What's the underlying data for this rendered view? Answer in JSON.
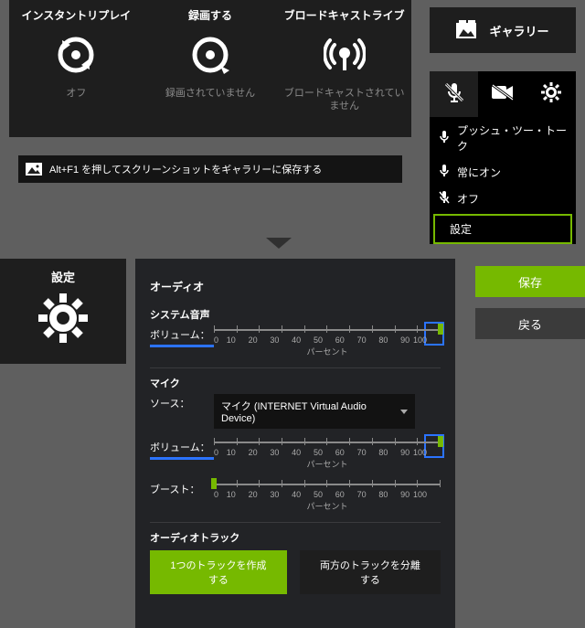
{
  "top": {
    "tiles": [
      {
        "title": "インスタントリプレイ",
        "status": "オフ"
      },
      {
        "title": "録画する",
        "status": "録画されていません"
      },
      {
        "title": "ブロードキャストライブ",
        "status": "ブロードキャストされていません"
      }
    ],
    "tip": "Alt+F1 を押してスクリーンショットをギャラリーに保存する",
    "gallery": "ギャラリー",
    "micMenu": {
      "items": [
        "プッシュ・ツー・トーク",
        "常にオン",
        "オフ"
      ],
      "settings": "設定"
    }
  },
  "settings": {
    "leftLabel": "設定",
    "title": "オーディオ",
    "system": {
      "label": "システム音声",
      "volumeLabel": "ボリューム：",
      "value": 100
    },
    "mic": {
      "label": "マイク",
      "sourceLabel": "ソース：",
      "source": "マイク (INTERNET Virtual Audio Device)",
      "volumeLabel": "ボリューム：",
      "value": 100,
      "boostLabel": "ブースト：",
      "boost": 0
    },
    "tracks": {
      "label": "オーディオトラック",
      "single": "1つのトラックを作成する",
      "split": "両方のトラックを分離する"
    },
    "saveBtn": "保存",
    "backBtn": "戻る",
    "scale": {
      "ticks": [
        0,
        10,
        20,
        30,
        40,
        50,
        60,
        70,
        80,
        90,
        100
      ],
      "unit": "パーセント"
    }
  }
}
